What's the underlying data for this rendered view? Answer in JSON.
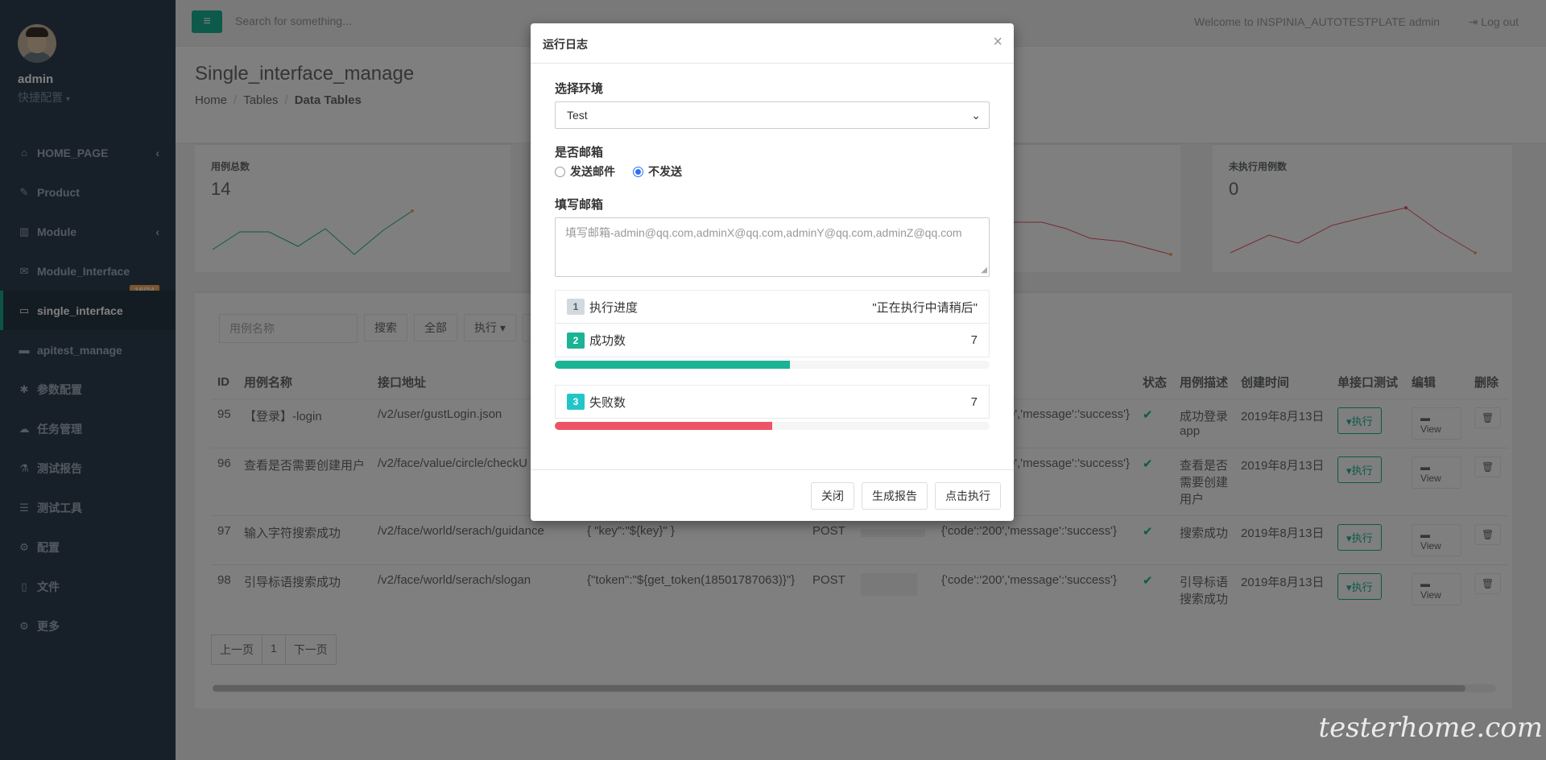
{
  "sidebar": {
    "profile_name": "admin",
    "profile_role": "快捷配置",
    "items": [
      {
        "label": "HOME_PAGE",
        "icon": "home-icon",
        "has_arrow": true
      },
      {
        "label": "Product",
        "icon": "edit-icon"
      },
      {
        "label": "Module",
        "icon": "bar-chart-icon",
        "has_arrow": true
      },
      {
        "label": "Module_Interface",
        "icon": "envelope-icon",
        "badge": "16/24"
      },
      {
        "label": "single_interface",
        "icon": "folder-open-icon",
        "active": true
      },
      {
        "label": "apitest_manage",
        "icon": "folder-icon"
      },
      {
        "label": "参数配置",
        "icon": "asterisk-icon"
      },
      {
        "label": "任务管理",
        "icon": "cloud-upload-icon"
      },
      {
        "label": "测试报告",
        "icon": "flask-icon"
      },
      {
        "label": "测试工具",
        "icon": "database-icon"
      },
      {
        "label": "配置",
        "icon": "gear-icon"
      },
      {
        "label": "文件",
        "icon": "file-icon"
      },
      {
        "label": "更多",
        "icon": "gears-icon"
      }
    ]
  },
  "topbar": {
    "search_placeholder": "Search for something...",
    "welcome": "Welcome to INSPINIA_AUTOTESTPLATE admin",
    "logout": "Log out"
  },
  "heading": {
    "title": "Single_interface_manage",
    "breadcrumb": [
      "Home",
      "Tables",
      "Data Tables"
    ]
  },
  "cards": [
    {
      "label": "用例总数",
      "value": "14"
    },
    {
      "label": "未执行用例数",
      "value": "0"
    }
  ],
  "table": {
    "search_placeholder": "用例名称",
    "buttons": {
      "search": "搜索",
      "all": "全部",
      "execute": "执行"
    },
    "headers": [
      "ID",
      "用例名称",
      "接口地址",
      "状态",
      "用例描述",
      "创建时间",
      "单接口测试",
      "编辑",
      "删除"
    ],
    "rows": [
      {
        "id": "95",
        "name": "【登录】-login",
        "url": "/v2/user/gustLogin.json",
        "params": "",
        "method": "",
        "expect": "00','message':'success'}",
        "desc": "成功登录app",
        "created": "2019年8月13日"
      },
      {
        "id": "96",
        "name": "查看是否需要创建用户",
        "url": "/v2/face/value/circle/checkU",
        "params": "",
        "method": "",
        "expect": "00','message':'success'}",
        "desc": "查看是否需要创建用户",
        "created": "2019年8月13日"
      },
      {
        "id": "97",
        "name": "输入字符搜索成功",
        "url": "/v2/face/world/serach/guidance",
        "params": "{ \"key\":\"${key}\" }",
        "method": "POST",
        "expect": "{'code':'200','message':'success'}",
        "desc": "搜索成功",
        "created": "2019年8月13日"
      },
      {
        "id": "98",
        "name": "引导标语搜索成功",
        "url": "/v2/face/world/serach/slogan",
        "params": "{\"token\":\"${get_token(18501787063)}\"}",
        "method": "POST",
        "expect": "{'code':'200','message':'success'}",
        "desc": "引导标语搜索成功",
        "created": "2019年8月13日"
      }
    ],
    "exec_label": "执行",
    "view_label": "View",
    "pager": {
      "prev": "上一页",
      "page": "1",
      "next": "下一页"
    }
  },
  "modal": {
    "title": "运行日志",
    "close": "×",
    "env_label": "选择环境",
    "env_value": "Test",
    "email_label": "是否邮箱",
    "radio_send": "发送邮件",
    "radio_nosend": "不发送",
    "radio_selected": "不发送",
    "fill_email_label": "填写邮箱",
    "email_placeholder": "填写邮箱-admin@qq.com,adminX@qq.com,adminY@qq.com,adminZ@qq.com",
    "progress_items": [
      {
        "num": "1",
        "label": "执行进度",
        "value": "\"正在执行中请稍后\""
      },
      {
        "num": "2",
        "label": "成功数",
        "value": "7"
      },
      {
        "num": "3",
        "label": "失败数",
        "value": "7"
      }
    ],
    "success_fraction": 0.54,
    "fail_fraction": 0.5,
    "buttons": {
      "close": "关闭",
      "report": "生成报告",
      "run": "点击执行"
    }
  },
  "colors": {
    "sidebar_bg": "#2f4050",
    "accent_green": "#1ab394",
    "progress_green": "#1ab394",
    "progress_red": "#ed5565",
    "badge_gray": "#d1dade",
    "badge_teal": "#23c6c8"
  },
  "watermark": "testerhome.com"
}
